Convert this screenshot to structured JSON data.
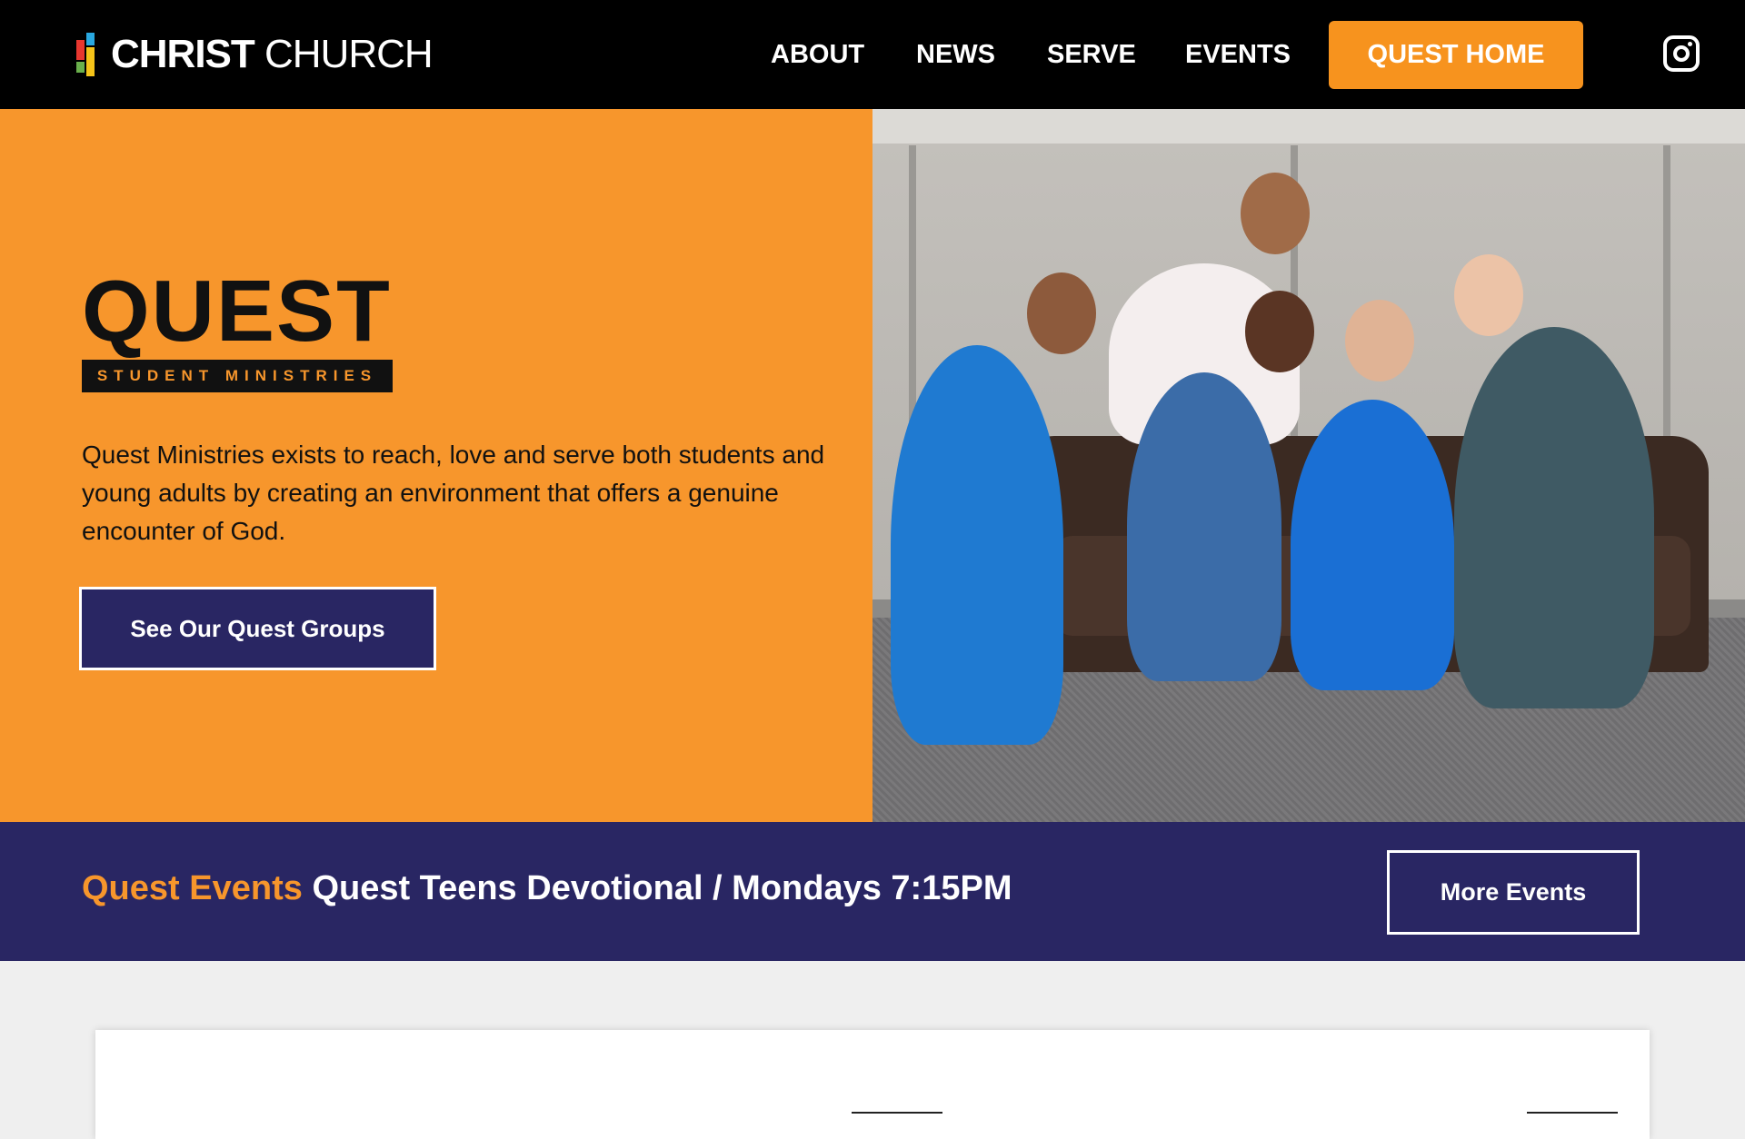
{
  "header": {
    "logo": {
      "bold": "CHRIST",
      "light": " CHURCH"
    },
    "nav": {
      "about": "ABOUT",
      "news": "NEWS",
      "serve": "SERVE",
      "events": "EVENTS",
      "quest_home": "QUEST HOME"
    },
    "icons": {
      "social": "instagram-icon"
    }
  },
  "hero": {
    "logo_word": "QUEST",
    "logo_subtitle": "STUDENT MINISTRIES",
    "description": "Quest Ministries exists to reach, love and serve both students and young adults by creating an environment that offers a genuine encounter of God.",
    "cta_label": "See Our Quest Groups"
  },
  "events_bar": {
    "label": "Quest Events",
    "event_text": "Quest Teens Devotional / Mondays 7:15PM",
    "more_label": "More Events"
  },
  "colors": {
    "brand_orange": "#f7962c",
    "brand_navy": "#292663",
    "header_bg": "#000000"
  }
}
